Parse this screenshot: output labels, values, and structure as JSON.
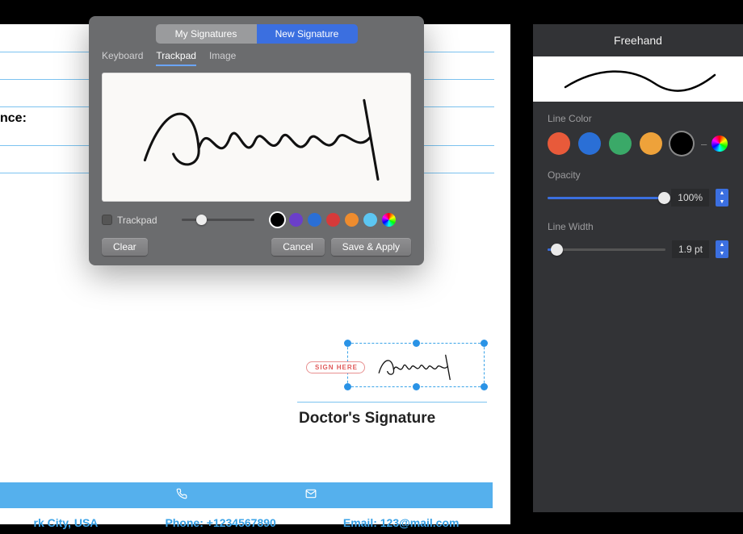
{
  "document": {
    "field_label_fragment": "nce:",
    "footer": {
      "location": "rk City, USA",
      "phone": "Phone: +1234567890",
      "email": "Email: 123@mail.com"
    },
    "signature_placeholder": {
      "sign_here": "SIGN HERE",
      "label": "Doctor's Signature"
    }
  },
  "modal": {
    "segments": {
      "left": "My Signatures",
      "right": "New Signature",
      "active": "right"
    },
    "tabs": [
      "Keyboard",
      "Trackpad",
      "Image"
    ],
    "active_tab": "Trackpad",
    "trackpad_label": "Trackpad",
    "swatches": [
      "#000000",
      "#6b3fc9",
      "#2a6fd6",
      "#d63a3a",
      "#ee8c2e",
      "#5cc6f2"
    ],
    "selected_swatch": 0,
    "buttons": {
      "clear": "Clear",
      "cancel": "Cancel",
      "save": "Save & Apply"
    }
  },
  "panel": {
    "title": "Freehand",
    "line_color": {
      "label": "Line Color",
      "swatches": [
        "#e85a3a",
        "#2a6fd6",
        "#3aa968",
        "#eea23a",
        "#000000"
      ],
      "selected": 4
    },
    "opacity": {
      "label": "Opacity",
      "value": "100%",
      "percent": 100
    },
    "line_width": {
      "label": "Line Width",
      "value": "1.9 pt",
      "percent": 8
    }
  }
}
